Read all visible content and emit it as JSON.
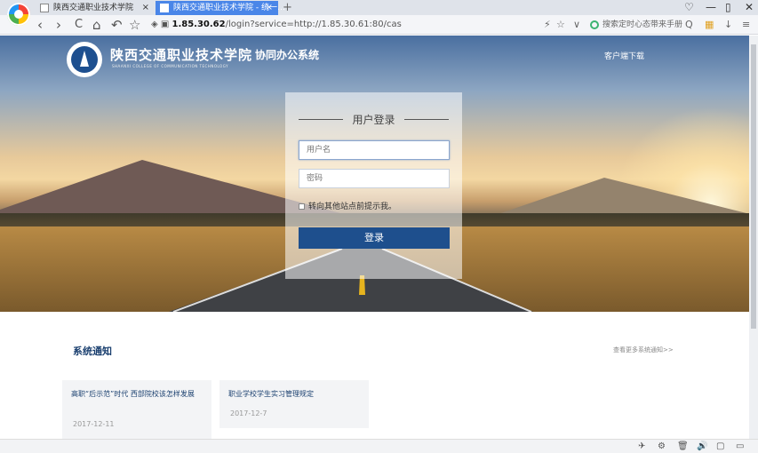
{
  "browser": {
    "tabs": [
      {
        "label": "陕西交通职业技术学院",
        "close": "×"
      },
      {
        "label": "陕西交通职业技术学院 - 统一…",
        "close": "×"
      }
    ],
    "new_tab": "+",
    "window_controls": [
      "♡",
      "—",
      "▯",
      "✕"
    ],
    "nav": [
      "‹",
      "›",
      "C",
      "⌂",
      "↶",
      "☆"
    ],
    "url_host": "1.85.30.62",
    "url_path": "/login?service=http://1.85.30.61:80/cas",
    "url_icons": [
      "⚡",
      "☆",
      "∨"
    ],
    "search_placeholder": "搜索定时心态带来手册",
    "toolbar_icons": [
      "Q",
      "▦",
      "↓",
      "≡"
    ]
  },
  "header": {
    "school_name": "陕西交通职业技术学院",
    "school_name_en": "SHAANXI COLLEGE OF COMMUNICATION TECHNOLOGY",
    "system_name": "协同办公系统",
    "client_download": "客户端下载"
  },
  "login": {
    "title": "用户登录",
    "username_placeholder": "用户名",
    "password_placeholder": "密码",
    "remember_label": "转向其他站点前提示我。",
    "submit_label": "登录"
  },
  "notices": {
    "title": "系统通知",
    "more": "查看更多系统通知>>",
    "items": [
      {
        "title": "高职“后示范”时代 西部院校该怎样发展",
        "date": "2017-12-11"
      },
      {
        "title": "职业学校学生实习管理规定",
        "date": "2017-12-7"
      }
    ]
  },
  "statusbar_icons": [
    "✈",
    "⚙",
    "🗑",
    "🔊",
    "▢",
    "▭"
  ],
  "colors": {
    "accent": "#1e4f8d",
    "tab_active": "#4a86e8"
  }
}
